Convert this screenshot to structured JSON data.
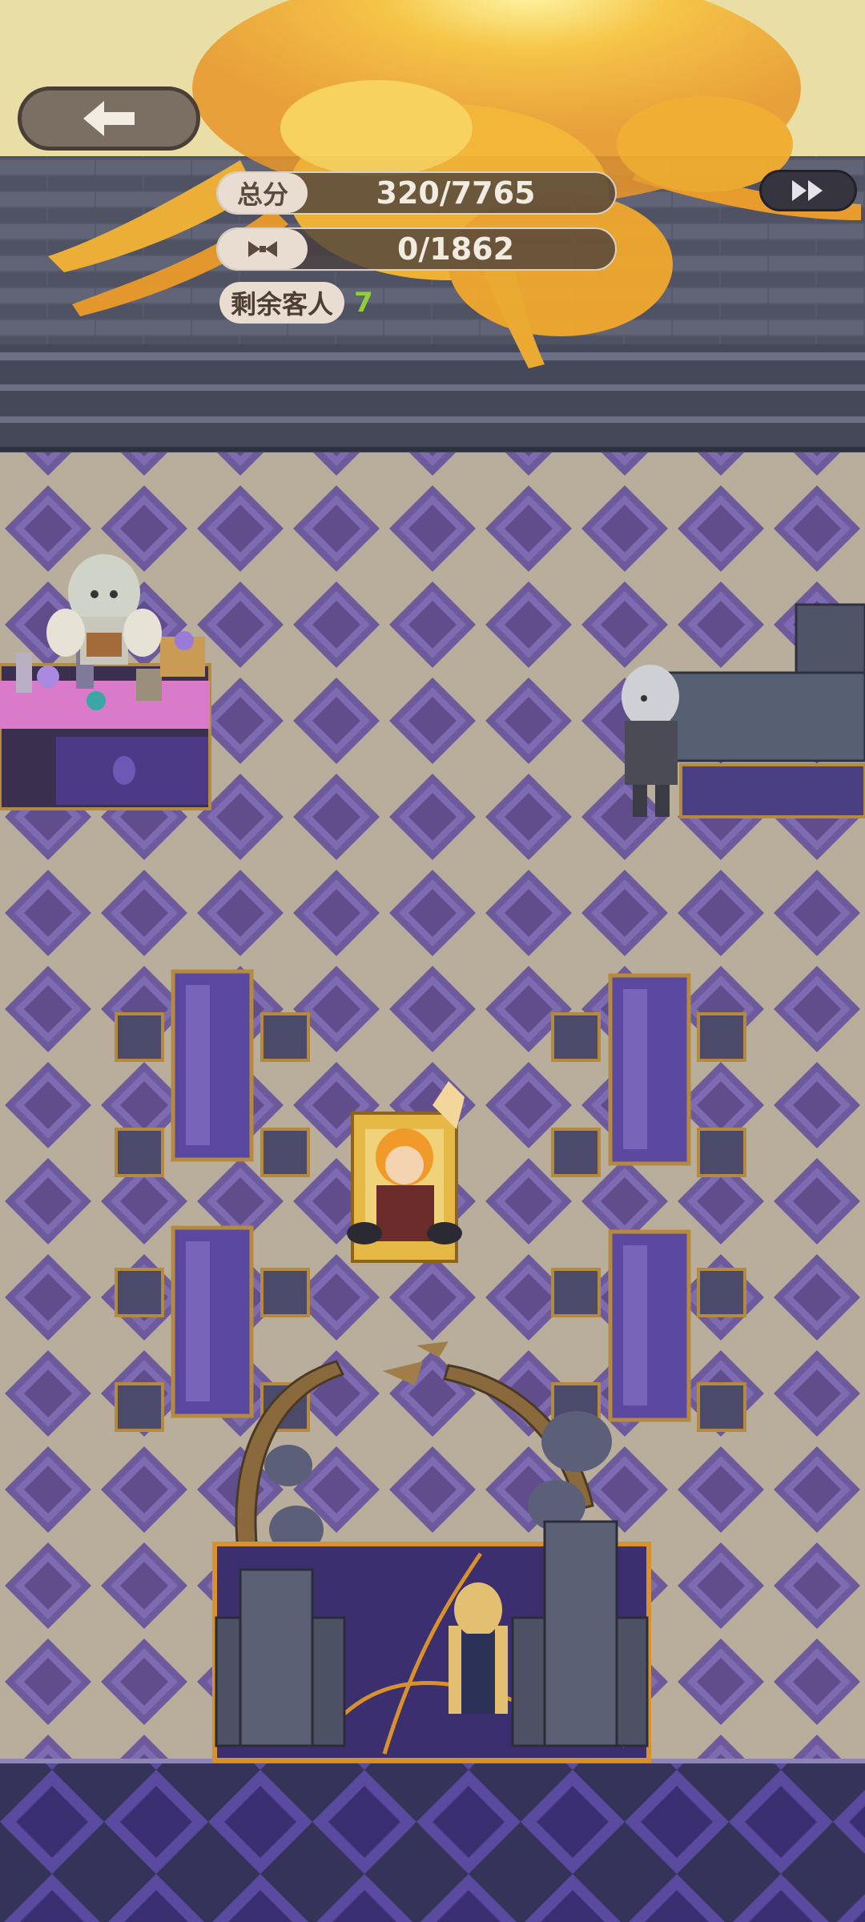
{
  "hud": {
    "total_score_label": "总分",
    "total_score_value": "320/7765",
    "bonus_value": "0/1862",
    "remaining_guests_label": "剩余客人",
    "remaining_guests_count": "7"
  },
  "colors": {
    "floor_light": "#b9ad9c",
    "floor_dark": "#6c5a9c",
    "wall": "#4e5262",
    "table_wood": "#b68a3c",
    "glow": "#f4b234"
  }
}
